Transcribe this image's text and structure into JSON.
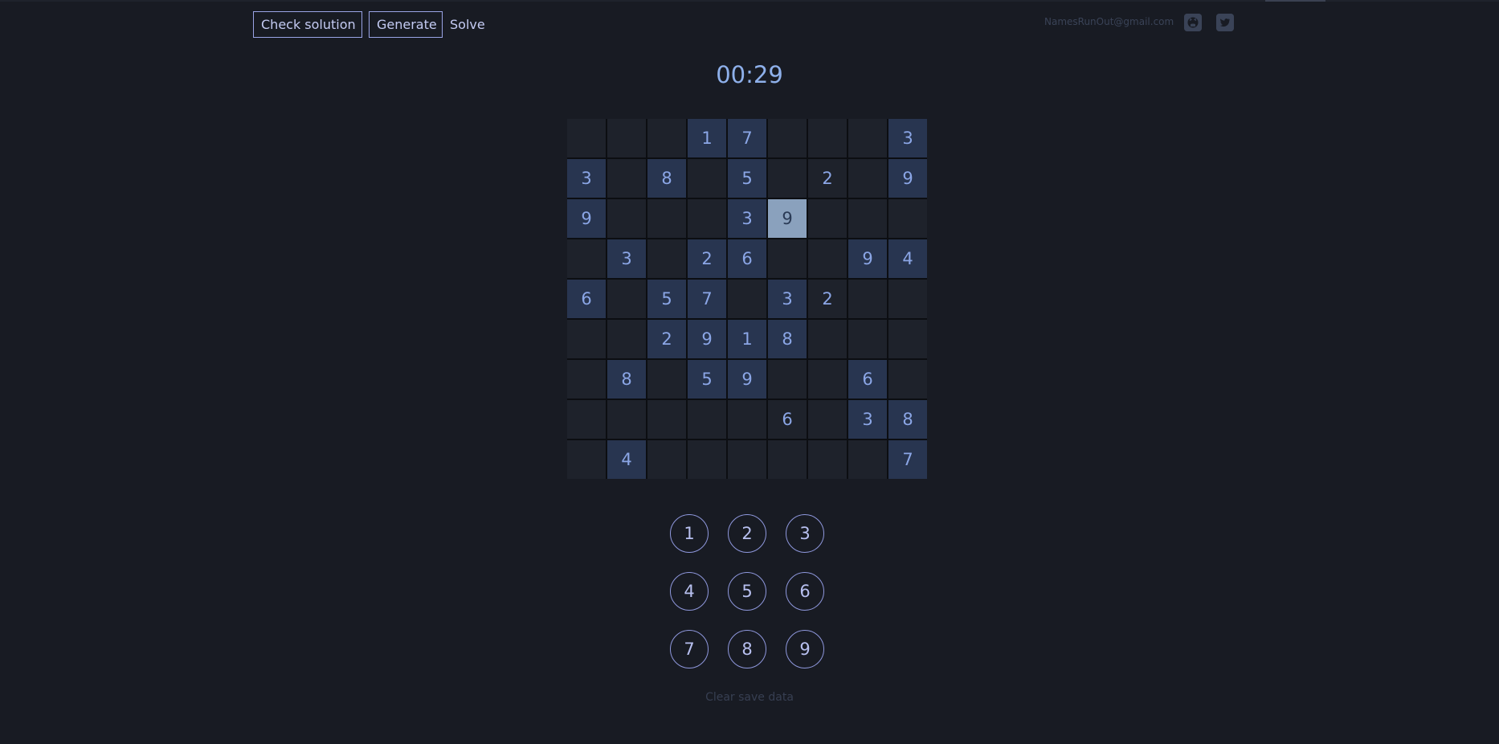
{
  "toolbar": {
    "check_label": "Check solution",
    "generate_label": "Generate",
    "solve_label": "Solve"
  },
  "header": {
    "email": "NamesRunOut@gmail.com",
    "icons": [
      "github-icon",
      "twitter-icon"
    ]
  },
  "timer": "00:29",
  "board": {
    "rows": [
      [
        "",
        "",
        "",
        "1",
        "7",
        "",
        "",
        "",
        "3"
      ],
      [
        "3",
        "",
        "8",
        "",
        "5",
        "",
        "2",
        "",
        "9"
      ],
      [
        "9",
        "",
        "",
        "",
        "3",
        "9",
        "",
        "",
        ""
      ],
      [
        "",
        "3",
        "",
        "2",
        "6",
        "",
        "",
        "9",
        "4"
      ],
      [
        "6",
        "",
        "5",
        "7",
        "",
        "3",
        "2",
        "",
        ""
      ],
      [
        "",
        "",
        "2",
        "9",
        "1",
        "8",
        "",
        "",
        ""
      ],
      [
        "",
        "8",
        "",
        "5",
        "9",
        "",
        "",
        "6",
        ""
      ],
      [
        "",
        "",
        "",
        "",
        "",
        "6",
        "",
        "3",
        "8"
      ],
      [
        "",
        "4",
        "",
        "",
        "",
        "",
        "",
        "",
        "7"
      ]
    ],
    "given": [
      [
        false,
        false,
        false,
        true,
        true,
        false,
        false,
        false,
        true
      ],
      [
        true,
        false,
        true,
        false,
        true,
        false,
        false,
        false,
        true
      ],
      [
        true,
        false,
        false,
        false,
        true,
        false,
        false,
        false,
        false
      ],
      [
        false,
        true,
        false,
        true,
        true,
        false,
        false,
        true,
        true
      ],
      [
        true,
        false,
        true,
        true,
        false,
        true,
        false,
        false,
        false
      ],
      [
        false,
        false,
        true,
        true,
        true,
        true,
        false,
        false,
        false
      ],
      [
        false,
        true,
        false,
        true,
        true,
        false,
        false,
        true,
        false
      ],
      [
        false,
        false,
        false,
        false,
        false,
        false,
        false,
        true,
        true
      ],
      [
        false,
        true,
        false,
        false,
        false,
        false,
        false,
        false,
        true
      ]
    ],
    "selected": {
      "row": 2,
      "col": 5
    }
  },
  "numpad": [
    "1",
    "2",
    "3",
    "4",
    "5",
    "6",
    "7",
    "8",
    "9"
  ],
  "footer": {
    "clear_label": "Clear save data"
  },
  "colors": {
    "background": "#181b23",
    "given_cell": "#283550",
    "empty_cell": "#1e222b",
    "selected_cell": "#8aa1bd",
    "accent": "#8eb0ea"
  }
}
